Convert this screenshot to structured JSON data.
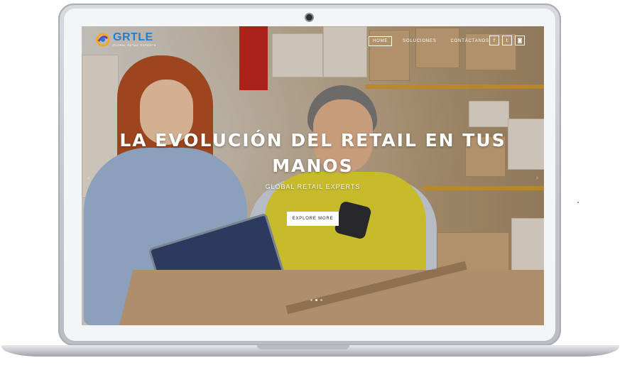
{
  "brand": {
    "logo_text": "GRTLE",
    "logo_tagline": "GLOBAL RETAIL EXPERTS",
    "logo_colors": [
      "#1f7fd6",
      "#f5a623",
      "#6a3fb5"
    ]
  },
  "nav": {
    "items": [
      {
        "label": "HOME",
        "active": true
      },
      {
        "label": "SOLUCIONES",
        "active": false
      },
      {
        "label": "CONTÁCTANOS",
        "active": false
      }
    ]
  },
  "social": [
    {
      "icon": "facebook-icon",
      "glyph": "f"
    },
    {
      "icon": "twitter-icon",
      "glyph": "t"
    },
    {
      "icon": "instagram-icon",
      "glyph": "◙"
    }
  ],
  "hero": {
    "title": "LA EVOLUCIÓN DEL RETAIL EN TUS MANOS",
    "subtitle": "GLOBAL RETAIL EXPERTS",
    "cta_label": "EXPLORE MORE"
  },
  "slider": {
    "dots": 3,
    "active_dot": 1,
    "prev_glyph": "‹",
    "next_glyph": "›"
  },
  "colors": {
    "shelf_orange": "#d79b2a",
    "accent_blue": "#1f7fd6",
    "text_white": "#ffffff"
  }
}
